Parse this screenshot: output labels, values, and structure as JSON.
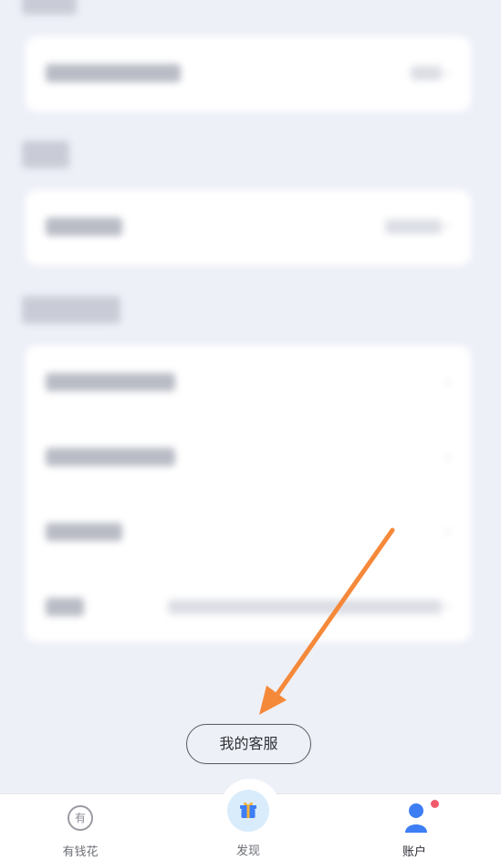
{
  "customer_service": {
    "label": "我的客服"
  },
  "bottom_nav": {
    "items": [
      {
        "label": "有钱花",
        "icon": "youqianhua-icon"
      },
      {
        "label": "发现",
        "icon": "gift-box-icon"
      },
      {
        "label": "账户",
        "icon": "account-person-icon"
      }
    ]
  },
  "colors": {
    "arrow": "#f5893a",
    "background": "#eef0f8",
    "discover_bg": "#d9ecfb",
    "badge": "#f05a6b"
  }
}
